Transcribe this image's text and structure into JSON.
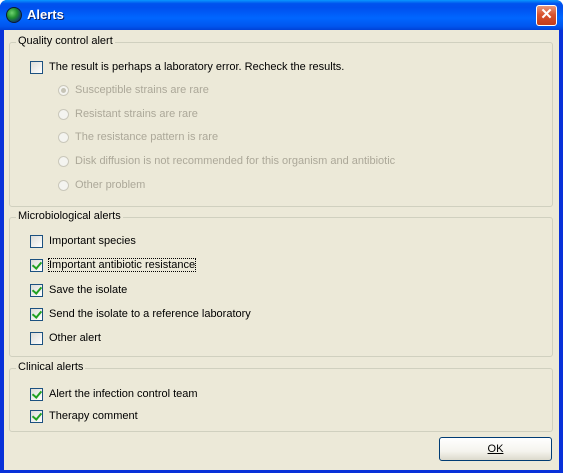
{
  "window": {
    "title": "Alerts"
  },
  "quality_group": {
    "legend": "Quality control alert",
    "main_check": {
      "label": "The result is perhaps a laboratory error.  Recheck the results.",
      "checked": false
    },
    "options": [
      {
        "label": "Susceptible strains are rare",
        "selected": true
      },
      {
        "label": "Resistant strains are rare",
        "selected": false
      },
      {
        "label": "The resistance pattern is rare",
        "selected": false
      },
      {
        "label": "Disk diffusion is not recommended for this organism and antibiotic",
        "selected": false
      },
      {
        "label": "Other problem",
        "selected": false
      }
    ]
  },
  "micro_group": {
    "legend": "Microbiological alerts",
    "items": [
      {
        "label": "Important species",
        "checked": false
      },
      {
        "label": "Important antibiotic resistance",
        "checked": true
      },
      {
        "label": "Save the isolate",
        "checked": true
      },
      {
        "label": "Send the isolate to a reference laboratory",
        "checked": true
      },
      {
        "label": "Other alert",
        "checked": false
      }
    ]
  },
  "clinical_group": {
    "legend": "Clinical alerts",
    "items": [
      {
        "label": "Alert the infection control team",
        "checked": true
      },
      {
        "label": "Therapy comment",
        "checked": true
      }
    ]
  },
  "buttons": {
    "ok": "OK"
  }
}
